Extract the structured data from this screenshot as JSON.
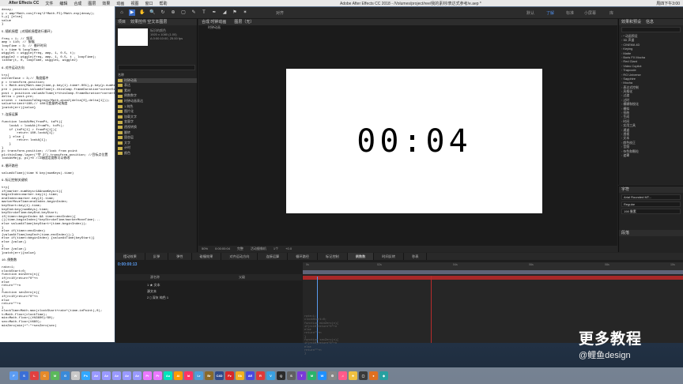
{
  "menubar": {
    "apple": "",
    "app": "After Effects CC",
    "items": [
      "文件",
      "编辑",
      "合成",
      "图层",
      "效果",
      "动画",
      "视图",
      "窗口",
      "帮助"
    ],
    "window_title": "Adobe After Effects CC 2018 - /Volumes/project/ree/我的素材/表达式参考/e.aep *",
    "right": [
      "周四下午3:00"
    ]
  },
  "notes": "decay;\ny = amp*Math.cos(freq*2*Math.PI)/Math.exp(decay);\nt,y] [else{\nvalue\n}\n\n5.随机摇摆 (对随机摇摆进行循环)\n\nfreq = 1; // 频率\namp = 110; // 振幅\nloopTime = 3; // 循环时间\nt = time % loopTime;\nwiggle1 = wiggle(freq, amp, 1, 0.5, t);\nwiggle2 = wiggle(freq, amp, 1, 0.5, t - loopTime);\nlinear(t, 0, loopTime, wiggle1, wiggle2)\n\n6.对齐运动方向\n\ntry{\ncornerEase = 3;// 角度缓冲\np = transform.position;\nt = Math.min(Math.max(time,p.key(1).time+.001),p.key(p.numKeys).time);\npre = position.valueAtTime(t-thisComp.frameDuration*cornerEase);\npost = position.valueAtTime(t+thisComp.frameDuration*cornerEase);\ndelta = post-pre;\norient = radiansToDegrees(Math.atan2(delta[0],delta[1]));\nvalue+orient+180;// 180可变量转动角度\n}catch(err){value}\n\n7.连接运算\n\nfunction lookAtMe(fromPt, toPt){\n    lookA = lookAt(fromPt, toPt);\n    if (toPt[1] > fromPt[1]){\n        return 180-lookA[1];\n    } else {\n        return lookA[1];\n    }\n}\np= transform.position; //look from point\np1=thisComp.layer(\"空 2\").transform.position; //目标点位置\nlookAtMe(p, p1)+0 //Z轴固定度数可以修改\n\n8.循环路径\n\nvalueAtTime((time % key(numKeys).time)\n\n9.标记控制关键帧\n\ntry{\nif(marker.numKeys>1&&numKeys>1){\nbeginIndex=marker.key(1).time;\nendIndex=marker.key(2).time;\nmarkerMoveTime=endIndex-beginIndex;\nkeyStart=key(1).time;\nkeyEnd=key(numKeys).time;\nkeyStrokeTime=keyEnd-keyStart;\nif(time>=beginIndex && time<=endIndex){\n(((time-beginIndex)*keyStrokeTime/markerMoveTime)...\nelse valueAtTime(keyStart+(time-beginIndex));\n}\nelse if(time>=endIndex)\n{valueAtTime(keyEnd+(time-endIndex));}\nelse if(time<=beginIndex) {valueAtTime(keyStart)}\nelse {value;}\n}\nelse {value;}\n}catch(err){value}\n\n10.倒数数\n\nrate=1;\nclockStart=0;\nfunction minZero(n){\nif(n<10)return\"0\"+n\nelse\nreturn\"\"+n\n}\nfunction secZero(n){\nif(n<10)return\"0\"+n\nelse\nreturn\"\"+n\n}\nclockTime=Math.max(clockStart+rate*(time-inPoint),0);\nt=Math.floor(clockTime);\nmin=Math.floor((t%3600)/60);\nsec=Math.floor(t%60);\nminZero(min)+\":\"+secZero(sec)",
  "toolbar": {
    "tools": [
      "⌂",
      "▶",
      "✋",
      "🔍",
      "↻",
      "⊕",
      "▢",
      "✎",
      "T",
      "✒",
      "◢",
      "⚑",
      "✶"
    ],
    "snap_label": "对齐",
    "workspaces": [
      "默认",
      "了解",
      "标准",
      "小屏幕",
      "库"
    ],
    "active_workspace": "标准"
  },
  "project": {
    "tabs": [
      "项目",
      "效果控件 空文本图层"
    ],
    "meta": [
      "标识的颜色",
      "1920 x 1080 (1.00)",
      "Δ 0:00:10:00, 25.00 fps"
    ],
    "items": [
      "名称",
      "时钟动画",
      "表达",
      "素材",
      "倒数数字",
      "时钟动画表达",
      "1 纯色",
      "图片化",
      "加载文字",
      "变量字",
      "透视转换",
      "翻转",
      "固态层",
      "文字",
      "计时",
      "颜色"
    ]
  },
  "viewer": {
    "tabs": [
      "合成 时钟动画",
      "图层（无）"
    ],
    "sub": "时钟动画",
    "timer": "00:04",
    "footer": [
      "50%",
      "0:00:00:04",
      "完整",
      "活动摄像机",
      "1个",
      "+0.0"
    ]
  },
  "effects": {
    "tabs": [
      "效果和预设",
      "信息"
    ],
    "items": [
      "* 动画预设",
      "3D 声道",
      "CINEMA 4D",
      "Keying",
      "Matte",
      "Boris FX Mocha",
      "Red Giant",
      "Video Copilot",
      "Trapcode",
      "RG Universe",
      "Sapphire",
      "Mocha",
      "表达式控制",
      "风格化",
      "过渡",
      "过时",
      "模糊和锐化",
      "模拟",
      "扭曲",
      "生成",
      "时间",
      "实用工具",
      "通道",
      "透视",
      "文本",
      "颜色校正",
      "音频",
      "杂色和颗粒",
      "遮罩"
    ]
  },
  "character": {
    "title": "字符",
    "font": "Arial Rounded MT...",
    "style": "Regular",
    "size": "198 像素",
    "paragraph": "段落"
  },
  "timeline": {
    "tabs": [
      "摆动效果",
      "反弹",
      "弹性",
      "碰撞效果",
      "对齐运动方向",
      "连接运算",
      "循环路径",
      "标记控制",
      "倒数数",
      "时间反转",
      "秒表"
    ],
    "active_tab": "倒数数",
    "timecode": "0:00:00:13",
    "columns": [
      "源名称",
      "父级"
    ],
    "layers": [
      {
        "name": "1 ★ 文本"
      },
      {
        "name": "   源文本"
      },
      {
        "name": "2 ▯ 深灰 纯色 1"
      }
    ],
    "ruler": [
      "0s",
      "02s",
      "04s",
      "06s",
      "08s",
      "10s"
    ],
    "code": "rate=1;\nclockStart=0;\nfunction minZero(n){\nif(n<10)return\"0\"+n\nelse\nreturn\"\"+n\n}\nfunction secZero(n){\nif(n<10)return\"0\"+n\nelse\nreturn\"\"+n\n}"
  },
  "watermark": {
    "title": "更多教程",
    "sub": "@鲤鱼design"
  },
  "dock": {
    "icons": [
      "F",
      "S",
      "L",
      "C",
      "M",
      "G",
      "W",
      "Ps",
      "Ae",
      "Ae",
      "Ae",
      "Ae",
      "Ae",
      "Pr",
      "Pr",
      "Au",
      "Ai",
      "Id",
      "Lr",
      "Br",
      "C4D",
      "Fz",
      "Sk",
      "AE",
      "R",
      "V",
      "Q",
      "S",
      "T",
      "M",
      "W",
      "⚙",
      "♫",
      "★",
      "▢",
      "●",
      "◆"
    ],
    "colors": [
      "#5c9cf2",
      "#3b6fd6",
      "#e04040",
      "#e58a2a",
      "#5bb85b",
      "#3a8ad8",
      "#c8c8c8",
      "#31a8ff",
      "#9999ff",
      "#9999ff",
      "#9999ff",
      "#9999ff",
      "#9999ff",
      "#ea77ff",
      "#ea77ff",
      "#00e4bb",
      "#ff9a00",
      "#ff3366",
      "#4d9ed8",
      "#8a6a2a",
      "#2f4a8a",
      "#d82828",
      "#f0b020",
      "#4a4ae0",
      "#e03a3a",
      "#3aa0e0",
      "#2a2a2a",
      "#606060",
      "#7a3ad8",
      "#2ab46a",
      "#1e90ff",
      "#888888",
      "#ff5a8a",
      "#f0c040",
      "#3a3a3a",
      "#e07020",
      "#28a0a0"
    ]
  }
}
